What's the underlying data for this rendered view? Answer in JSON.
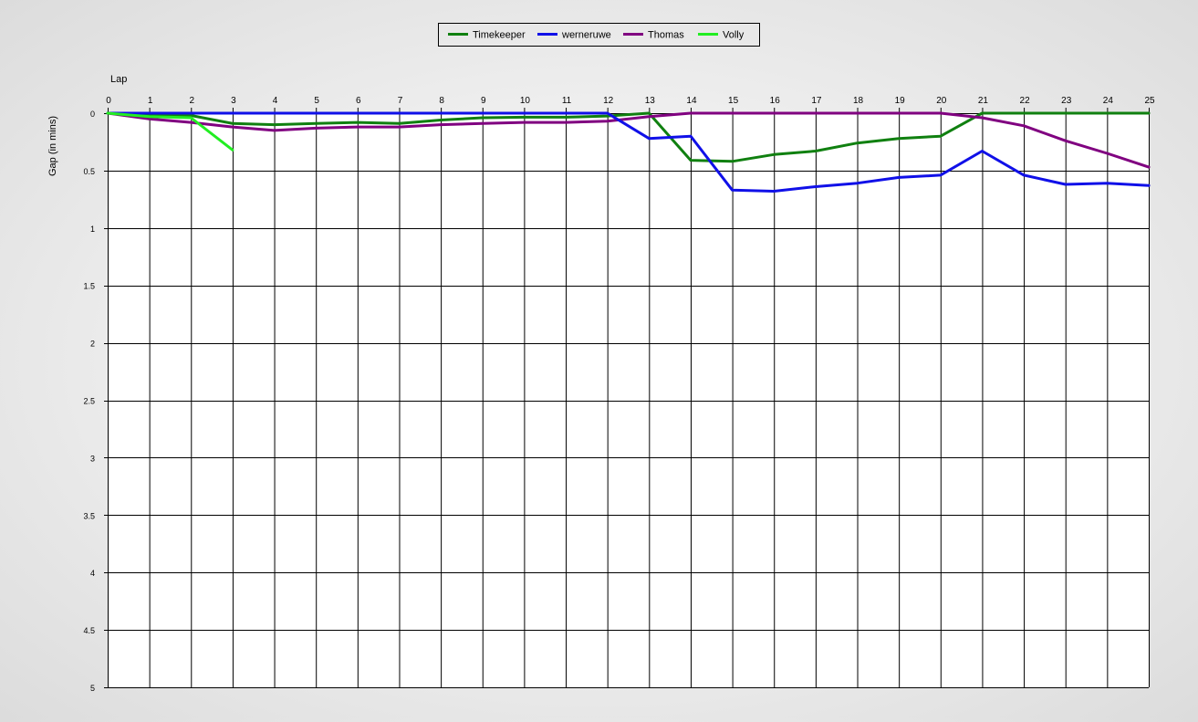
{
  "chart_data": {
    "type": "line",
    "title": "",
    "xlabel": "Lap",
    "ylabel": "Gap (in mins)",
    "x": [
      0,
      1,
      2,
      3,
      4,
      5,
      6,
      7,
      8,
      9,
      10,
      11,
      12,
      13,
      14,
      15,
      16,
      17,
      18,
      19,
      20,
      21,
      22,
      23,
      24,
      25
    ],
    "x_ticks": [
      "0",
      "1",
      "2",
      "3",
      "4",
      "5",
      "6",
      "7",
      "8",
      "9",
      "10",
      "11",
      "12",
      "13",
      "14",
      "15",
      "16",
      "17",
      "18",
      "19",
      "20",
      "21",
      "22",
      "23",
      "24",
      "25"
    ],
    "y_ticks": [
      "0",
      "0.5",
      "1",
      "1.5",
      "2",
      "2.5",
      "3",
      "3.5",
      "4",
      "4.5",
      "5"
    ],
    "xlim": [
      0,
      25
    ],
    "ylim": [
      0,
      5
    ],
    "y_inverted": true,
    "x_axis_position": "top",
    "grid": true,
    "legend_position": "top-center",
    "series": [
      {
        "name": "Timekeeper",
        "color": "#108010",
        "values": [
          0,
          0.02,
          0.02,
          0.09,
          0.1,
          0.09,
          0.08,
          0.09,
          0.06,
          0.04,
          0.035,
          0.035,
          0.025,
          0,
          0.41,
          0.42,
          0.36,
          0.33,
          0.26,
          0.22,
          0.2,
          0,
          0,
          0,
          0,
          0
        ]
      },
      {
        "name": "werneruwe",
        "color": "#1010e8",
        "values": [
          0,
          0,
          0,
          0,
          0,
          0,
          0,
          0,
          0,
          0,
          0,
          0,
          0,
          0.22,
          0.2,
          0.67,
          0.68,
          0.64,
          0.61,
          0.56,
          0.54,
          0.33,
          0.54,
          0.62,
          0.61,
          0.63
        ]
      },
      {
        "name": "Thomas",
        "color": "#800080",
        "values": [
          0,
          0.05,
          0.08,
          0.12,
          0.15,
          0.13,
          0.12,
          0.12,
          0.1,
          0.09,
          0.08,
          0.08,
          0.07,
          0.03,
          0,
          0,
          0,
          0,
          0,
          0,
          0,
          0.04,
          0.11,
          0.24,
          0.35,
          0.47
        ]
      },
      {
        "name": "Volly",
        "color": "#22ee22",
        "values": [
          0,
          0.03,
          0.04,
          0.32
        ]
      }
    ]
  }
}
